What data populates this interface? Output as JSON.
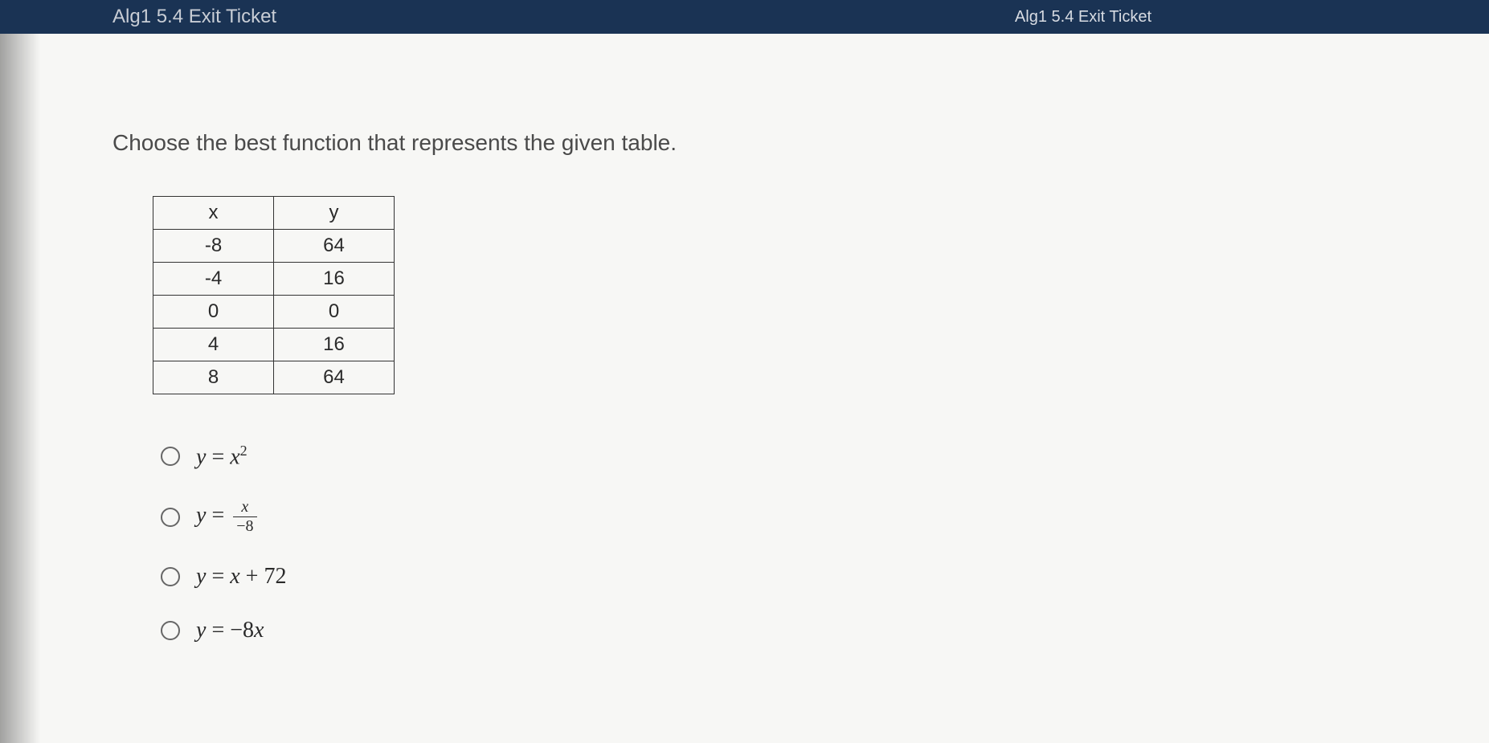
{
  "header": {
    "breadcrumb_left": "Alg1 5.4 Exit Ticket",
    "breadcrumb_right": "Alg1 5.4 Exit Ticket"
  },
  "question": {
    "prompt": "Choose the best function that represents the given table."
  },
  "table": {
    "headers": [
      "x",
      "y"
    ],
    "rows": [
      [
        "-8",
        "64"
      ],
      [
        "-4",
        "16"
      ],
      [
        "0",
        "0"
      ],
      [
        "4",
        "16"
      ],
      [
        "8",
        "64"
      ]
    ]
  },
  "options": [
    {
      "id": "opt1",
      "display_type": "squared",
      "var": "y",
      "eq": "=",
      "x": "x",
      "exp": "2"
    },
    {
      "id": "opt2",
      "display_type": "fraction",
      "var": "y",
      "eq": "=",
      "num": "x",
      "den": "−8"
    },
    {
      "id": "opt3",
      "display_type": "linear",
      "var": "y",
      "eq": "=",
      "x": "x",
      "op": "+",
      "const": "72"
    },
    {
      "id": "opt4",
      "display_type": "coef",
      "var": "y",
      "eq": "=",
      "coef": "−8",
      "x": "x"
    }
  ]
}
